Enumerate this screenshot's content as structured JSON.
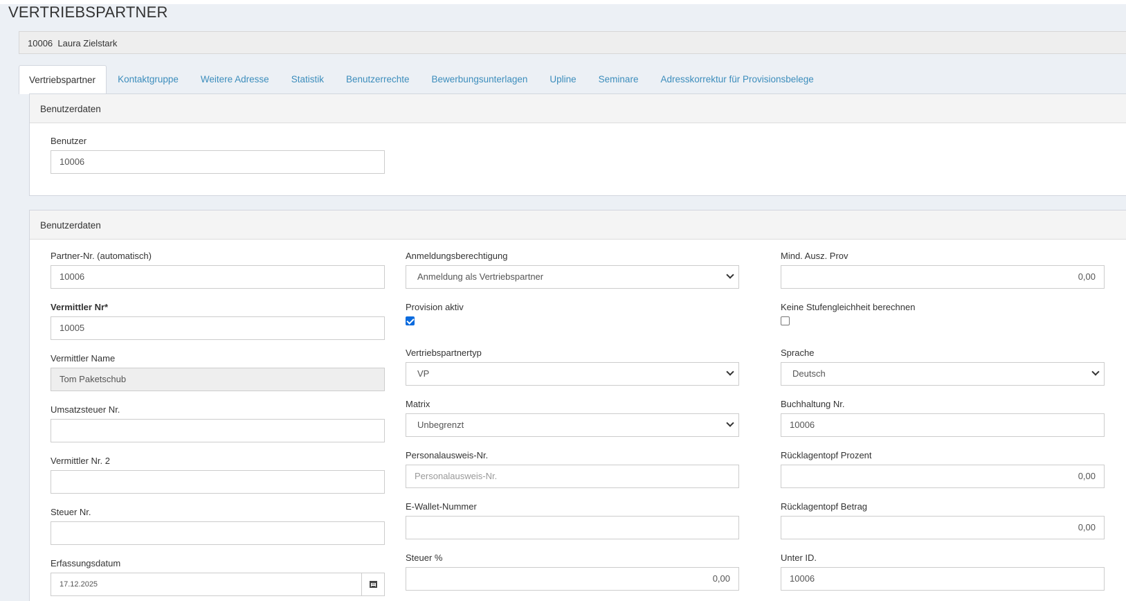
{
  "page": {
    "title": "VERTRIEBSPARTNER"
  },
  "partner_bar": {
    "id": "10006",
    "name": "Laura Zielstark"
  },
  "tabs": [
    {
      "label": "Vertriebspartner",
      "active": true
    },
    {
      "label": "Kontaktgruppe"
    },
    {
      "label": "Weitere Adresse"
    },
    {
      "label": "Statistik"
    },
    {
      "label": "Benutzerrechte"
    },
    {
      "label": "Bewerbungsunterlagen"
    },
    {
      "label": "Upline"
    },
    {
      "label": "Seminare"
    },
    {
      "label": "Adresskorrektur für Provisionsbelege"
    }
  ],
  "panel1": {
    "heading": "Benutzerdaten",
    "benutzer_label": "Benutzer",
    "benutzer_value": "10006"
  },
  "panel2": {
    "heading": "Benutzerdaten",
    "col1": {
      "partner_nr_label": "Partner-Nr. (automatisch)",
      "partner_nr_value": "10006",
      "vermittler_nr_label": "Vermittler Nr*",
      "vermittler_nr_value": "10005",
      "vermittler_name_label": "Vermittler Name",
      "vermittler_name_value": "Tom Paketschub",
      "ust_label": "Umsatzsteuer Nr.",
      "ust_value": "",
      "vermittler_nr2_label": "Vermittler Nr. 2",
      "vermittler_nr2_value": "",
      "steuer_nr_label": "Steuer Nr.",
      "steuer_nr_value": "",
      "erfassungsdatum_label": "Erfassungsdatum",
      "erfassungsdatum_value": "17.12.2025"
    },
    "col2": {
      "anmeldung_label": "Anmeldungsberechtigung",
      "anmeldung_value": "Anmeldung als Vertriebspartner",
      "provision_label": "Provision aktiv",
      "provision_checked": true,
      "vp_typ_label": "Vertriebspartnertyp",
      "vp_typ_value": "VP",
      "matrix_label": "Matrix",
      "matrix_value": "Unbegrenzt",
      "ausweis_label": "Personalausweis-Nr.",
      "ausweis_placeholder": "Personalausweis-Nr.",
      "ewallet_label": "E-Wallet-Nummer",
      "ewallet_value": "",
      "steuer_pct_label": "Steuer %",
      "steuer_pct_value": "0,00"
    },
    "col3": {
      "mind_label": "Mind. Ausz. Prov",
      "mind_value": "0,00",
      "stufen_label": "Keine Stufengleichheit berechnen",
      "stufen_checked": false,
      "sprache_label": "Sprache",
      "sprache_value": "Deutsch",
      "buchhaltung_label": "Buchhaltung Nr.",
      "buchhaltung_value": "10006",
      "ruecklage_pct_label": "Rücklagentopf Prozent",
      "ruecklage_pct_value": "0,00",
      "ruecklage_betrag_label": "Rücklagentopf Betrag",
      "ruecklage_betrag_value": "0,00",
      "unter_id_label": "Unter ID.",
      "unter_id_value": "10006"
    }
  }
}
